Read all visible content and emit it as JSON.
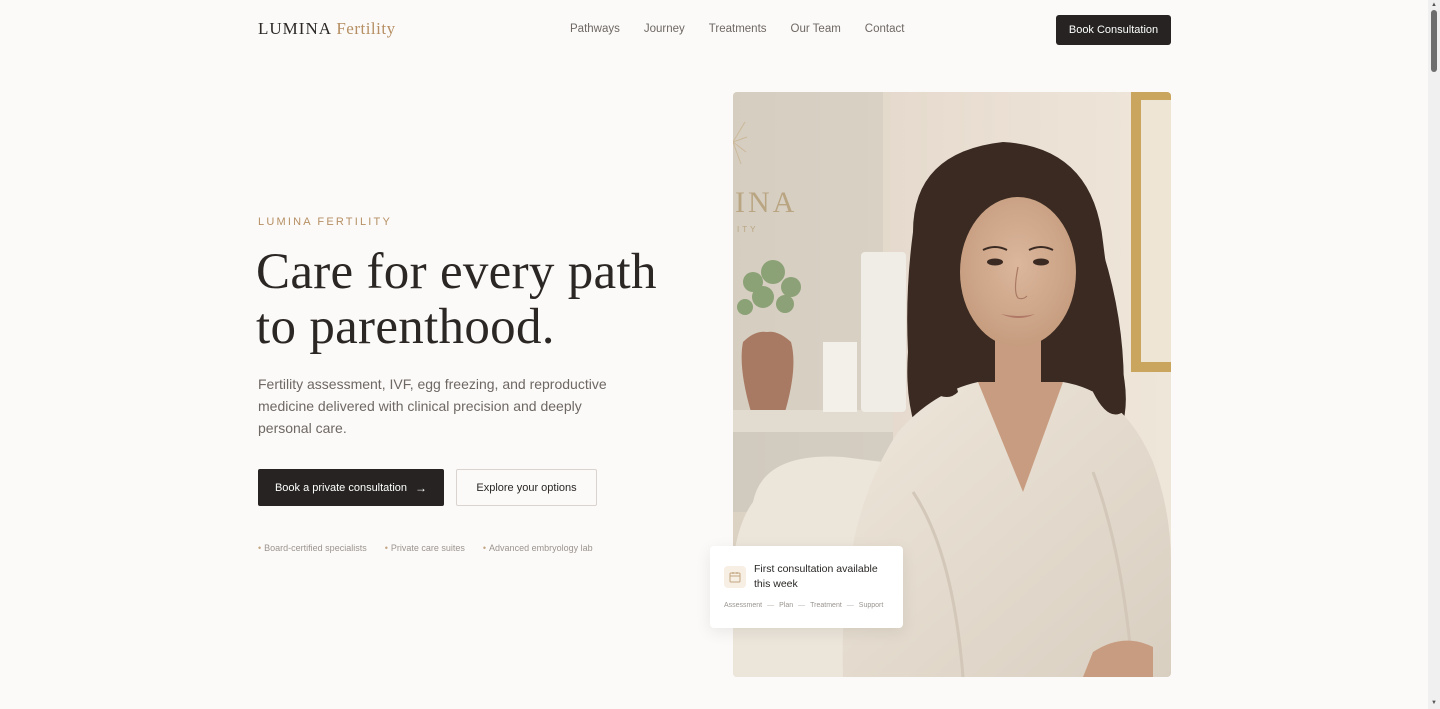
{
  "nav": {
    "logo_main": "LUMINA",
    "logo_accent": "Fertility",
    "links": [
      "Pathways",
      "Journey",
      "Treatments",
      "Our Team",
      "Contact"
    ],
    "cta_label": "Book Consultation"
  },
  "hero": {
    "eyebrow": "LUMINA FERTILITY",
    "title_line1": "Care for every path",
    "title_line2": "to parenthood.",
    "description": "Fertility assessment, IVF, egg freezing, and reproductive medicine delivered with clinical precision and deeply personal care.",
    "primary_label": "Book a private consultation",
    "secondary_label": "Explore your options",
    "features": [
      "Board-certified specialists",
      "Private care suites",
      "Advanced embryology lab"
    ]
  },
  "image": {
    "wall_text": "INA",
    "wall_subtext": "ITY"
  },
  "card": {
    "title": "First consultation available this week",
    "steps": [
      "Assessment",
      "Plan",
      "Treatment",
      "Support"
    ]
  },
  "colors": {
    "accent": "#b58f63",
    "dark": "#262322",
    "background": "#fcfaf8"
  }
}
